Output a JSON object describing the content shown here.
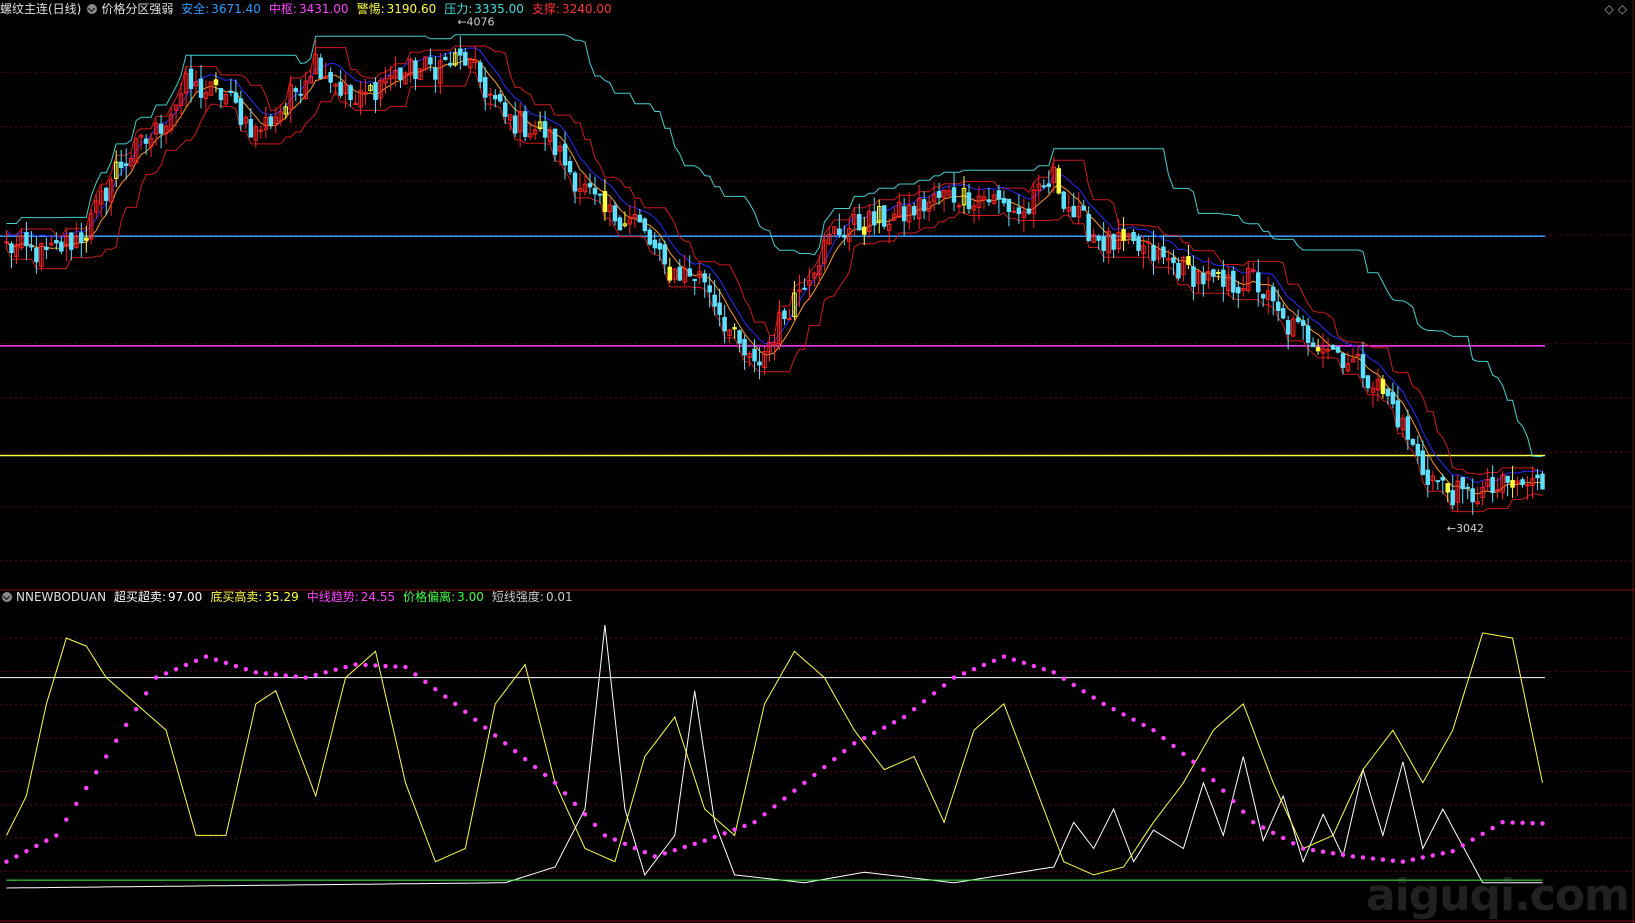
{
  "top_panel": {
    "title": "螺纹主连(日线)",
    "indicator": "价格分区强弱",
    "items": [
      {
        "label": "安全:",
        "value": "3671.40",
        "color": "#2e9bff"
      },
      {
        "label": "中枢:",
        "value": "3431.00",
        "color": "#ff40ff"
      },
      {
        "label": "警惕:",
        "value": "3190.60",
        "color": "#ffff40"
      },
      {
        "label": "压力:",
        "value": "3335.00",
        "color": "#40e0e0"
      },
      {
        "label": "支撑:",
        "value": "3240.00",
        "color": "#ff3030"
      }
    ],
    "high_marker": "4076",
    "low_marker": "3042",
    "nav_icons": [
      "diamond-left-icon",
      "diamond-right-icon"
    ]
  },
  "bottom_panel": {
    "indicator": "NNEWBODUAN",
    "items": [
      {
        "label": "超买超卖:",
        "value": "97.00",
        "color": "#ffffff"
      },
      {
        "label": "底买高卖:",
        "value": "35.29",
        "color": "#ffff40"
      },
      {
        "label": "中线趋势:",
        "value": "24.55",
        "color": "#ff40ff"
      },
      {
        "label": "价格偏离:",
        "value": "3.00",
        "color": "#40ff40"
      },
      {
        "label": "短线强度:",
        "value": "0.01",
        "color": "#c8c8c8"
      }
    ]
  },
  "watermark": "aiguqi.com",
  "chart_data": [
    {
      "type": "candlestick",
      "ylim": [
        2900,
        4150
      ],
      "levels": [
        {
          "name": "安全",
          "value": 3671.4,
          "color": "#2e9bff"
        },
        {
          "name": "中枢",
          "value": 3431.0,
          "color": "#ff40ff"
        },
        {
          "name": "警惕",
          "value": 3190.6,
          "color": "#ffff40"
        }
      ],
      "close_path": [
        [
          0,
          3650
        ],
        [
          8,
          3630
        ],
        [
          16,
          3680
        ],
        [
          22,
          3820
        ],
        [
          30,
          3900
        ],
        [
          36,
          4000
        ],
        [
          44,
          3980
        ],
        [
          50,
          3900
        ],
        [
          56,
          3960
        ],
        [
          62,
          4060
        ],
        [
          70,
          3960
        ],
        [
          76,
          4020
        ],
        [
          84,
          4040
        ],
        [
          92,
          4060
        ],
        [
          100,
          3930
        ],
        [
          108,
          3900
        ],
        [
          114,
          3800
        ],
        [
          120,
          3720
        ],
        [
          126,
          3710
        ],
        [
          132,
          3600
        ],
        [
          140,
          3580
        ],
        [
          146,
          3440
        ],
        [
          150,
          3380
        ],
        [
          154,
          3460
        ],
        [
          160,
          3580
        ],
        [
          166,
          3680
        ],
        [
          172,
          3700
        ],
        [
          180,
          3720
        ],
        [
          188,
          3760
        ],
        [
          196,
          3760
        ],
        [
          204,
          3720
        ],
        [
          210,
          3800
        ],
        [
          214,
          3720
        ],
        [
          220,
          3660
        ],
        [
          228,
          3640
        ],
        [
          236,
          3600
        ],
        [
          244,
          3560
        ],
        [
          250,
          3580
        ],
        [
          256,
          3480
        ],
        [
          264,
          3440
        ],
        [
          272,
          3380
        ],
        [
          278,
          3300
        ],
        [
          284,
          3160
        ],
        [
          288,
          3120
        ],
        [
          292,
          3100
        ],
        [
          300,
          3120
        ],
        [
          308,
          3130
        ],
        [
          316,
          3080
        ]
      ]
    },
    {
      "type": "line",
      "ylim": [
        0,
        100
      ],
      "overbought": 80,
      "series": [
        {
          "name": "超买超卖",
          "color": "#ffffff",
          "values": [
            [
              0,
              0
            ],
            [
              100,
              2
            ],
            [
              110,
              8
            ],
            [
              116,
              30
            ],
            [
              120,
              100
            ],
            [
              124,
              30
            ],
            [
              128,
              5
            ],
            [
              134,
              20
            ],
            [
              138,
              75
            ],
            [
              142,
              25
            ],
            [
              146,
              5
            ],
            [
              160,
              2
            ],
            [
              172,
              6
            ],
            [
              190,
              2
            ],
            [
              210,
              8
            ],
            [
              214,
              25
            ],
            [
              218,
              15
            ],
            [
              222,
              30
            ],
            [
              226,
              10
            ],
            [
              230,
              22
            ],
            [
              236,
              15
            ],
            [
              240,
              40
            ],
            [
              244,
              20
            ],
            [
              248,
              50
            ],
            [
              252,
              18
            ],
            [
              256,
              35
            ],
            [
              260,
              10
            ],
            [
              264,
              28
            ],
            [
              268,
              12
            ],
            [
              272,
              45
            ],
            [
              276,
              20
            ],
            [
              280,
              48
            ],
            [
              284,
              15
            ],
            [
              288,
              30
            ],
            [
              296,
              2
            ]
          ]
        },
        {
          "name": "底买高卖",
          "color": "#ffff40",
          "values": [
            [
              0,
              20
            ],
            [
              4,
              35
            ],
            [
              8,
              70
            ],
            [
              12,
              95
            ],
            [
              16,
              92
            ],
            [
              20,
              80
            ],
            [
              26,
              70
            ],
            [
              32,
              60
            ],
            [
              38,
              20
            ],
            [
              44,
              20
            ],
            [
              50,
              70
            ],
            [
              54,
              75
            ],
            [
              58,
              55
            ],
            [
              62,
              35
            ],
            [
              68,
              80
            ],
            [
              74,
              90
            ],
            [
              80,
              40
            ],
            [
              86,
              10
            ],
            [
              92,
              15
            ],
            [
              98,
              70
            ],
            [
              104,
              85
            ],
            [
              110,
              40
            ],
            [
              116,
              15
            ],
            [
              122,
              10
            ],
            [
              128,
              50
            ],
            [
              134,
              65
            ],
            [
              140,
              30
            ],
            [
              146,
              20
            ],
            [
              152,
              70
            ],
            [
              158,
              90
            ],
            [
              164,
              80
            ],
            [
              170,
              60
            ],
            [
              176,
              45
            ],
            [
              182,
              50
            ],
            [
              188,
              25
            ],
            [
              194,
              60
            ],
            [
              200,
              70
            ],
            [
              206,
              40
            ],
            [
              212,
              10
            ],
            [
              218,
              5
            ],
            [
              224,
              8
            ],
            [
              230,
              25
            ],
            [
              236,
              40
            ],
            [
              242,
              60
            ],
            [
              248,
              70
            ],
            [
              254,
              40
            ],
            [
              260,
              15
            ],
            [
              266,
              20
            ],
            [
              272,
              45
            ],
            [
              278,
              60
            ],
            [
              284,
              40
            ],
            [
              290,
              60
            ],
            [
              296,
              97
            ],
            [
              302,
              95
            ],
            [
              308,
              40
            ]
          ]
        },
        {
          "name": "中线趋势",
          "color": "#ff40ff",
          "values": [
            [
              0,
              10
            ],
            [
              10,
              20
            ],
            [
              20,
              50
            ],
            [
              30,
              80
            ],
            [
              40,
              88
            ],
            [
              50,
              82
            ],
            [
              60,
              80
            ],
            [
              70,
              85
            ],
            [
              80,
              84
            ],
            [
              90,
              70
            ],
            [
              100,
              55
            ],
            [
              110,
              40
            ],
            [
              120,
              20
            ],
            [
              130,
              12
            ],
            [
              140,
              18
            ],
            [
              150,
              25
            ],
            [
              160,
              40
            ],
            [
              170,
              55
            ],
            [
              180,
              65
            ],
            [
              190,
              80
            ],
            [
              200,
              88
            ],
            [
              210,
              82
            ],
            [
              220,
              70
            ],
            [
              230,
              60
            ],
            [
              240,
              45
            ],
            [
              250,
              25
            ],
            [
              260,
              15
            ],
            [
              270,
              12
            ],
            [
              280,
              10
            ],
            [
              290,
              14
            ],
            [
              300,
              25
            ],
            [
              308,
              24.55
            ]
          ]
        },
        {
          "name": "价格偏离",
          "color": "#40ff40",
          "values": [
            [
              0,
              3
            ],
            [
              308,
              3
            ]
          ]
        }
      ]
    }
  ]
}
